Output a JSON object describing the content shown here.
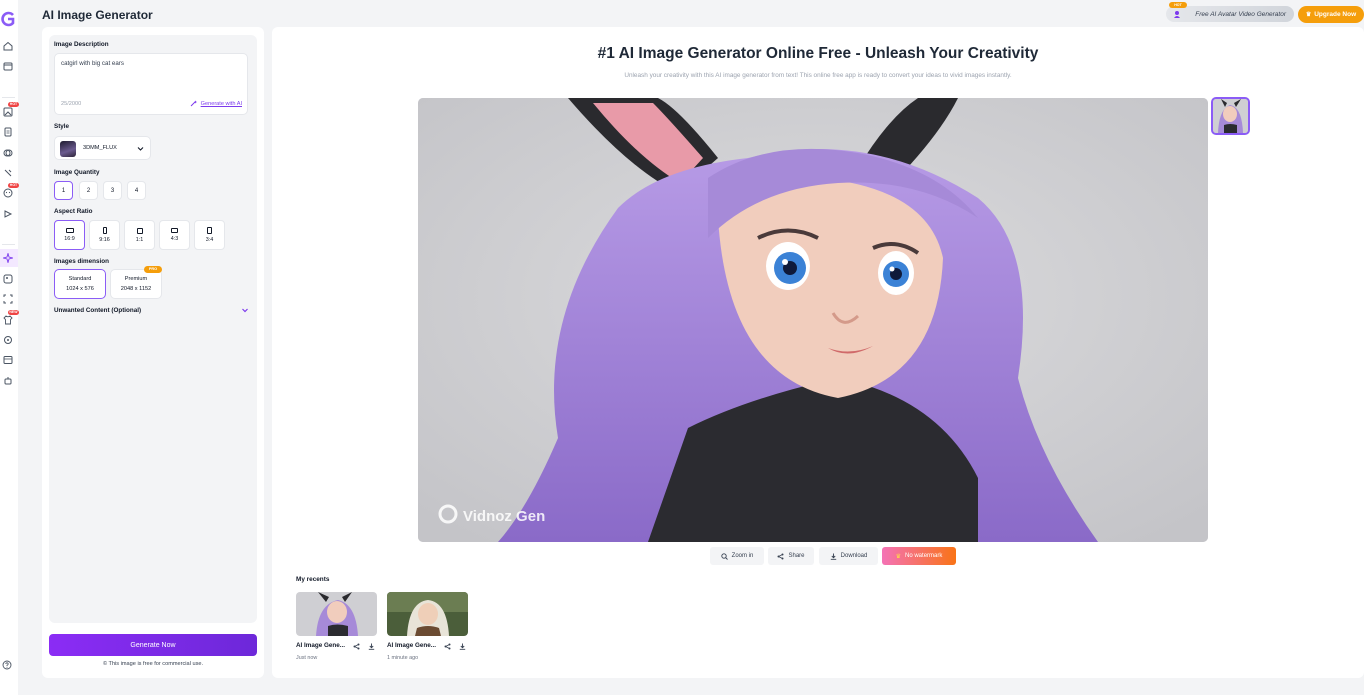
{
  "header": {
    "title": "AI Image Generator",
    "promo_badge": "HOT",
    "promo_label": "Free AI Avatar Video Generator",
    "upgrade_label": "Upgrade Now"
  },
  "rail": {
    "hot_badge_1": "HOT",
    "hot_badge_2": "HOT",
    "new_badge": "NEW",
    "icons": [
      "home-icon",
      "box-icon",
      "image-edit-icon",
      "document-icon",
      "layers-icon",
      "tool-icon",
      "face-icon",
      "video-icon",
      "sparkle-icon",
      "picture-icon",
      "scan-icon",
      "shirt-icon",
      "cycle-icon",
      "film-icon",
      "robot-icon",
      "help-icon"
    ]
  },
  "form": {
    "description_label": "Image Description",
    "description_value": "catgirl with big cat ears",
    "char_count": "25/2000",
    "generate_with_ai": "Generate with AI",
    "style_label": "Style",
    "style_value": "3DMM_FLUX",
    "quantity_label": "Image Quantity",
    "quantities": [
      "1",
      "2",
      "3",
      "4"
    ],
    "aspect_label": "Aspect Ratio",
    "aspects": [
      "16:9",
      "9:16",
      "1:1",
      "4:3",
      "3:4"
    ],
    "dimension_label": "Images dimension",
    "dimensions": [
      {
        "name": "Standard",
        "size": "1024 x 576"
      },
      {
        "name": "Premium",
        "size": "2048 x 1152"
      }
    ],
    "pro_badge": "PRO",
    "unwanted_label": "Unwanted Content (Optional)",
    "generate_button": "Generate Now",
    "free_note": "This image is free for commercial use."
  },
  "main": {
    "title": "#1 AI Image Generator Online Free - Unleash Your Creativity",
    "subtitle": "Unleash your creativity with this AI image generator from text! This online free app is ready to convert your ideas to vivid images instantly.",
    "watermark": "Vidnoz Gen",
    "actions": [
      "Zoom in",
      "Share",
      "Download",
      "No watermark"
    ],
    "recents_label": "My recents",
    "recents": [
      {
        "name": "AI Image Gene...",
        "time": "Just now"
      },
      {
        "name": "AI Image Gene...",
        "time": "1 minute ago"
      }
    ]
  },
  "colors": {
    "accent": "#7c3aed",
    "upgrade": "#f59e0b",
    "hot": "#ef4444"
  }
}
